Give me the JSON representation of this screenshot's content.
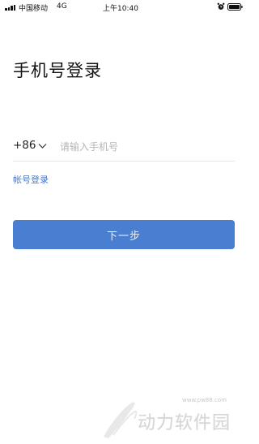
{
  "status_bar": {
    "carrier": "中国移动",
    "network": "4G",
    "time": "上午10:40",
    "icons": [
      "signal-icon",
      "alarm-icon",
      "battery-icon"
    ]
  },
  "login": {
    "title": "手机号登录",
    "country_code": "+86",
    "phone_placeholder": "请输入手机号",
    "phone_value": "",
    "account_login_label": "帐号登录",
    "next_button_label": "下一步"
  },
  "watermark": {
    "url": "www.pw88.com",
    "text": "动力软件园"
  },
  "colors": {
    "accent": "#4a7ed0",
    "link": "#4a79c2",
    "placeholder": "#b5b5b5",
    "divider": "#e6e6e6"
  }
}
